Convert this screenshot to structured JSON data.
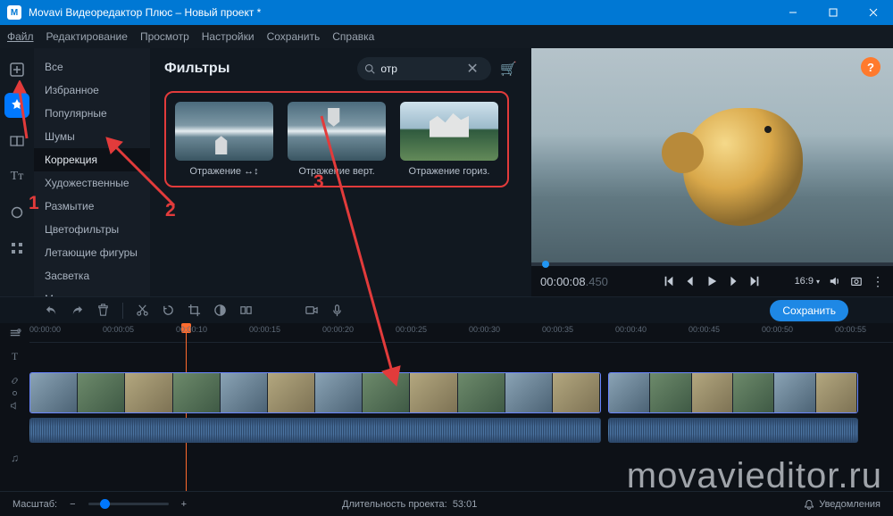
{
  "window": {
    "title": "Movavi Видеоредактор Плюс – Новый проект *",
    "app_badge": "M"
  },
  "menu": [
    "Файл",
    "Редактирование",
    "Просмотр",
    "Настройки",
    "Сохранить",
    "Справка"
  ],
  "tool_rail": [
    {
      "name": "add-media-icon"
    },
    {
      "name": "filters-icon",
      "active": true
    },
    {
      "name": "transitions-icon"
    },
    {
      "name": "titles-icon",
      "text": "Tт"
    },
    {
      "name": "stickers-icon"
    },
    {
      "name": "more-tools-icon"
    }
  ],
  "categories": [
    "Все",
    "Избранное",
    "Популярные",
    "Шумы",
    "Коррекция",
    "Художественные",
    "Размытие",
    "Цветофильтры",
    "Летающие фигуры",
    "Засветка",
    "Мозаика"
  ],
  "selected_category_index": 4,
  "filter_panel": {
    "title": "Фильтры",
    "search_value": "отр",
    "search_placeholder": "",
    "cards": [
      {
        "label": "Отражение ↔↕",
        "thumb": "s1"
      },
      {
        "label": "Отражение верт.",
        "thumb": "s2"
      },
      {
        "label": "Отражение гориз.",
        "thumb": "s3"
      }
    ]
  },
  "preview": {
    "timecode": "00:00:08",
    "timecode_ms": ".450",
    "aspect": "16:9"
  },
  "toolbar_save": "Сохранить",
  "ruler_marks": [
    "00:00:00",
    "00:00:05",
    "00:00:10",
    "00:00:15",
    "00:00:20",
    "00:00:25",
    "00:00:30",
    "00:00:35",
    "00:00:40",
    "00:00:45",
    "00:00:50",
    "00:00:55"
  ],
  "footer": {
    "zoom_label": "Масштаб:",
    "duration_label": "Длительность проекта:",
    "duration_value": "53:01",
    "notifications": "Уведомления"
  },
  "annotations": {
    "n1": "1",
    "n2": "2",
    "n3": "3"
  },
  "watermark": "movavieditor.ru"
}
